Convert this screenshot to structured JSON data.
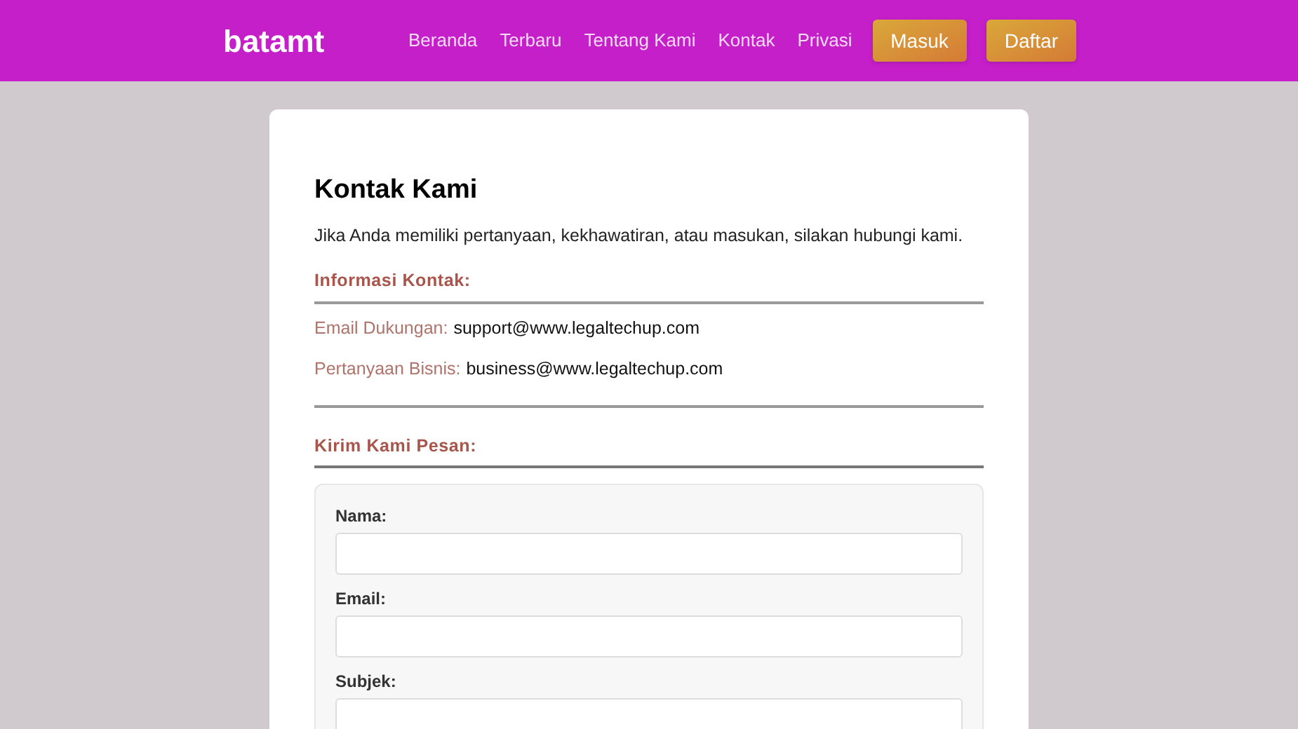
{
  "header": {
    "logo": "batamt",
    "nav": [
      "Beranda",
      "Terbaru",
      "Tentang Kami",
      "Kontak",
      "Privasi"
    ],
    "buttons": [
      "Masuk",
      "Daftar"
    ]
  },
  "page": {
    "title": "Kontak Kami",
    "intro": "Jika Anda memiliki pertanyaan, kekhawatiran, atau masukan, silakan hubungi kami.",
    "contact_heading": "Informasi Kontak:",
    "contacts": [
      {
        "label": "Email Dukungan:",
        "value": "support@www.legaltechup.com"
      },
      {
        "label": "Pertanyaan Bisnis:",
        "value": "business@www.legaltechup.com"
      }
    ],
    "form_heading": "Kirim Kami Pesan:",
    "fields": [
      {
        "label": "Nama:"
      },
      {
        "label": "Email:"
      },
      {
        "label": "Subjek:"
      }
    ]
  }
}
